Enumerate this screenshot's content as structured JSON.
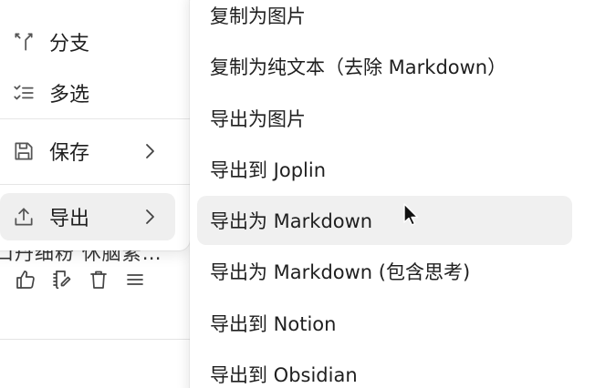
{
  "background": {
    "partial_text": "口丹细粉   休脑素…",
    "actions": [
      {
        "name": "like-icon"
      },
      {
        "name": "edit-icon"
      },
      {
        "name": "delete-icon"
      },
      {
        "name": "more-icon"
      }
    ]
  },
  "left_menu": {
    "items": [
      {
        "label": "分支",
        "icon": "branch-icon"
      },
      {
        "label": "多选",
        "icon": "multi-select-icon"
      },
      {
        "label": "保存",
        "icon": "save-icon",
        "has_submenu": true
      },
      {
        "label": "导出",
        "icon": "export-icon",
        "has_submenu": true,
        "active": true
      }
    ]
  },
  "export_submenu": {
    "items": [
      {
        "label": "复制为图片"
      },
      {
        "label": "复制为纯文本（去除 Markdown）"
      },
      {
        "label": "导出为图片"
      },
      {
        "label": "导出到 Joplin"
      },
      {
        "label": "导出为 Markdown",
        "hovered": true
      },
      {
        "label": "导出为 Markdown (包含思考)"
      },
      {
        "label": "导出到 Notion"
      },
      {
        "label": "导出到 Obsidian"
      }
    ]
  },
  "colors": {
    "text": "#1f1f1f",
    "icon": "#555555",
    "active_bg": "#efefef",
    "hover_bg": "#f0f0f0",
    "separator": "#e6e6e6"
  }
}
